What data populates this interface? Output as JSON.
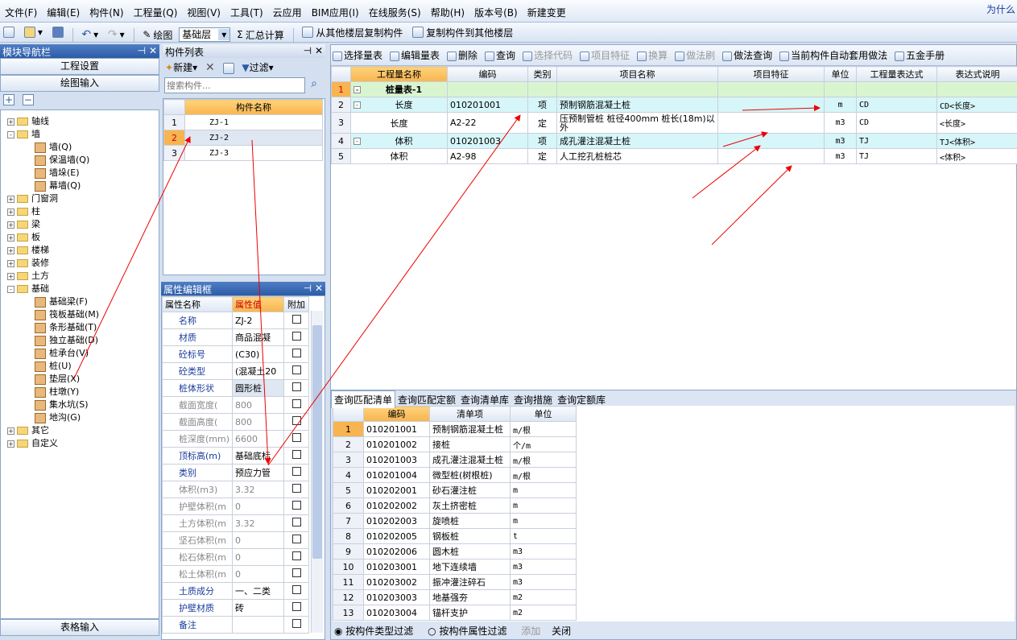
{
  "menu": [
    "文件(F)",
    "编辑(E)",
    "构件(N)",
    "工程量(Q)",
    "视图(V)",
    "工具(T)",
    "云应用",
    "BIM应用(I)",
    "在线服务(S)",
    "帮助(H)",
    "版本号(B)",
    "新建变更"
  ],
  "corner": "为什么",
  "toolbar": {
    "draw": "绘图",
    "floor": "基础层",
    "sum": "汇总计算",
    "copy_from": "从其他楼层复制构件",
    "copy_to": "复制构件到其他楼层"
  },
  "nav": {
    "title": "模块导航栏",
    "project_settings": "工程设置",
    "draw_input": "绘图输入",
    "table_input": "表格输入",
    "tree": [
      {
        "label": "轴线",
        "level": 0,
        "exp": "+"
      },
      {
        "label": "墙",
        "level": 0,
        "exp": "-"
      },
      {
        "label": "墙(Q)",
        "level": 1
      },
      {
        "label": "保温墙(Q)",
        "level": 1
      },
      {
        "label": "墙垛(E)",
        "level": 1
      },
      {
        "label": "幕墙(Q)",
        "level": 1
      },
      {
        "label": "门窗洞",
        "level": 0,
        "exp": "+"
      },
      {
        "label": "柱",
        "level": 0,
        "exp": "+"
      },
      {
        "label": "梁",
        "level": 0,
        "exp": "+"
      },
      {
        "label": "板",
        "level": 0,
        "exp": "+"
      },
      {
        "label": "楼梯",
        "level": 0,
        "exp": "+"
      },
      {
        "label": "装修",
        "level": 0,
        "exp": "+"
      },
      {
        "label": "土方",
        "level": 0,
        "exp": "+"
      },
      {
        "label": "基础",
        "level": 0,
        "exp": "-"
      },
      {
        "label": "基础梁(F)",
        "level": 1
      },
      {
        "label": "筏板基础(M)",
        "level": 1
      },
      {
        "label": "条形基础(T)",
        "level": 1
      },
      {
        "label": "独立基础(D)",
        "level": 1
      },
      {
        "label": "桩承台(V)",
        "level": 1
      },
      {
        "label": "桩(U)",
        "level": 1
      },
      {
        "label": "垫层(X)",
        "level": 1
      },
      {
        "label": "柱墩(Y)",
        "level": 1
      },
      {
        "label": "集水坑(S)",
        "level": 1
      },
      {
        "label": "地沟(G)",
        "level": 1
      },
      {
        "label": "其它",
        "level": 0,
        "exp": "+"
      },
      {
        "label": "自定义",
        "level": 0,
        "exp": "+"
      }
    ]
  },
  "list": {
    "title": "构件列表",
    "new": "新建",
    "filter": "过滤",
    "search_ph": "搜索构件...",
    "col": "构件名称",
    "rows": [
      {
        "n": "1",
        "name": "ZJ-1"
      },
      {
        "n": "2",
        "name": "ZJ-2"
      },
      {
        "n": "3",
        "name": "ZJ-3"
      }
    ]
  },
  "props": {
    "title": "属性编辑框",
    "h1": "属性名称",
    "h2": "属性值",
    "h3": "附加",
    "rows": [
      {
        "k": "名称",
        "v": "ZJ-2",
        "g": false
      },
      {
        "k": "材质",
        "v": "商品混凝",
        "g": false
      },
      {
        "k": "砼标号",
        "v": "(C30)",
        "g": false
      },
      {
        "k": "砼类型",
        "v": "(混凝土20",
        "g": false
      },
      {
        "k": "桩体形状",
        "v": "圆形桩",
        "g": false
      },
      {
        "k": "截面宽度(",
        "v": "800",
        "g": true
      },
      {
        "k": "截面高度(",
        "v": "800",
        "g": true
      },
      {
        "k": "桩深度(mm)",
        "v": "6600",
        "g": true
      },
      {
        "k": "顶标高(m)",
        "v": "基础底标",
        "g": false
      },
      {
        "k": "类别",
        "v": "预应力管",
        "g": false
      },
      {
        "k": "体积(m3)",
        "v": "3.32",
        "g": true
      },
      {
        "k": "护壁体积(m",
        "v": "0",
        "g": true
      },
      {
        "k": "土方体积(m",
        "v": "3.32",
        "g": true
      },
      {
        "k": "坚石体积(m",
        "v": "0",
        "g": true
      },
      {
        "k": "松石体积(m",
        "v": "0",
        "g": true
      },
      {
        "k": "松土体积(m",
        "v": "0",
        "g": true
      },
      {
        "k": "土质成分",
        "v": "一、二类",
        "g": false
      },
      {
        "k": "护壁材质",
        "v": "砖",
        "g": false
      },
      {
        "k": "备注",
        "v": "",
        "g": false
      }
    ]
  },
  "qtb": {
    "tools": [
      "选择量表",
      "编辑量表",
      "删除",
      "查询",
      "选择代码",
      "项目特征",
      "换算",
      "做法刷",
      "做法查询",
      "当前构件自动套用做法",
      "五金手册"
    ],
    "cols": [
      "工程量名称",
      "编码",
      "类别",
      "项目名称",
      "项目特征",
      "单位",
      "工程量表达式",
      "表达式说明"
    ],
    "rows": [
      {
        "n": "1",
        "name": "桩量表-1",
        "code": "",
        "type": "",
        "item": "",
        "feat": "",
        "unit": "",
        "expr": "",
        "desc": ""
      },
      {
        "n": "2",
        "name": "长度",
        "code": "010201001",
        "type": "项",
        "item": "预制钢筋混凝土桩",
        "feat": "",
        "unit": "m",
        "expr": "CD",
        "desc": "CD<长度>"
      },
      {
        "n": "3",
        "name": "长度",
        "code": "A2-22",
        "type": "定",
        "item": "压预制管桩 桩径400mm 桩长(18m)以外",
        "feat": "",
        "unit": "m3",
        "expr": "CD",
        "desc": "<长度>"
      },
      {
        "n": "4",
        "name": "体积",
        "code": "010201003",
        "type": "项",
        "item": "成孔灌注混凝土桩",
        "feat": "",
        "unit": "m3",
        "expr": "TJ",
        "desc": "TJ<体积>"
      },
      {
        "n": "5",
        "name": "体积",
        "code": "A2-98",
        "type": "定",
        "item": "人工挖孔桩桩芯",
        "feat": "",
        "unit": "m3",
        "expr": "TJ",
        "desc": "<体积>"
      }
    ]
  },
  "bottom": {
    "tabs": [
      "查询匹配清单",
      "查询匹配定额",
      "查询清单库",
      "查询措施",
      "查询定额库"
    ],
    "cols": [
      "编码",
      "清单项",
      "单位"
    ],
    "rows": [
      [
        "1",
        "010201001",
        "预制钢筋混凝土桩",
        "m/根"
      ],
      [
        "2",
        "010201002",
        "接桩",
        "个/m"
      ],
      [
        "3",
        "010201003",
        "成孔灌注混凝土桩",
        "m/根"
      ],
      [
        "4",
        "010201004",
        "微型桩(树根桩)",
        "m/根"
      ],
      [
        "5",
        "010202001",
        "砂石灌注桩",
        "m"
      ],
      [
        "6",
        "010202002",
        "灰土挤密桩",
        "m"
      ],
      [
        "7",
        "010202003",
        "旋喷桩",
        "m"
      ],
      [
        "8",
        "010202005",
        "钢板桩",
        "t"
      ],
      [
        "9",
        "010202006",
        "圆木桩",
        "m3"
      ],
      [
        "10",
        "010203001",
        "地下连续墙",
        "m3"
      ],
      [
        "11",
        "010203002",
        "振冲灌注碎石",
        "m3"
      ],
      [
        "12",
        "010203003",
        "地基强夯",
        "m2"
      ],
      [
        "13",
        "010203004",
        "锚杆支护",
        "m2"
      ]
    ],
    "radio1": "按构件类型过滤",
    "radio2": "按构件属性过滤",
    "add": "添加",
    "close": "关闭"
  }
}
